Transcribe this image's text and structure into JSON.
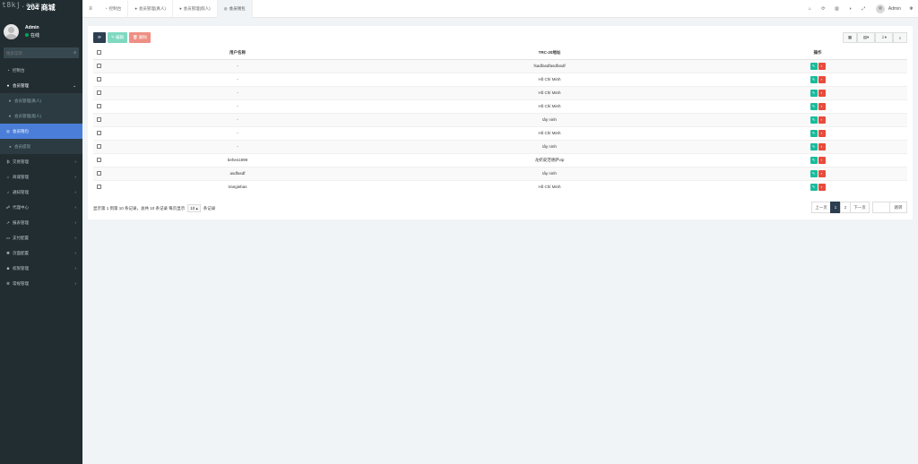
{
  "brand": {
    "watermark": "t8kj.com",
    "title": "204 商城"
  },
  "user": {
    "name": "Admin",
    "status": "在线"
  },
  "sidebar_search": {
    "placeholder": "搜索菜单"
  },
  "menu": [
    {
      "label": "控制台",
      "icon": "dashboard-icon",
      "glyph": "◔",
      "chevron": "",
      "state": ""
    },
    {
      "label": "会员管理",
      "icon": "user-icon",
      "glyph": "●",
      "chevron": "⌄",
      "state": "open"
    },
    {
      "label": "会员管理(真人)",
      "icon": "user-icon",
      "glyph": "●",
      "chevron": "",
      "state": "sub"
    },
    {
      "label": "会员管理(假人)",
      "icon": "user-icon",
      "glyph": "●",
      "chevron": "",
      "state": "sub"
    },
    {
      "label": "会员钱包",
      "icon": "wallet-icon",
      "glyph": "◎",
      "chevron": "",
      "state": "active"
    },
    {
      "label": "会员提现",
      "icon": "volume-icon",
      "glyph": "◂",
      "chevron": "",
      "state": "sub"
    },
    {
      "label": "交易管理",
      "icon": "bitcoin-icon",
      "glyph": "₿",
      "chevron": "‹",
      "state": ""
    },
    {
      "label": "商城管理",
      "icon": "home-icon",
      "glyph": "⌂",
      "chevron": "‹",
      "state": ""
    },
    {
      "label": "通知管理",
      "icon": "bell-icon",
      "glyph": "♪",
      "chevron": "‹",
      "state": ""
    },
    {
      "label": "代理中心",
      "icon": "sitemap-icon",
      "glyph": "☍",
      "chevron": "‹",
      "state": ""
    },
    {
      "label": "报表管理",
      "icon": "chart-icon",
      "glyph": "↗",
      "chevron": "‹",
      "state": ""
    },
    {
      "label": "支付配置",
      "icon": "card-icon",
      "glyph": "▭",
      "chevron": "‹",
      "state": ""
    },
    {
      "label": "页面配置",
      "icon": "gear-icon",
      "glyph": "✱",
      "chevron": "‹",
      "state": ""
    },
    {
      "label": "权限管理",
      "icon": "users-icon",
      "glyph": "☻",
      "chevron": "‹",
      "state": ""
    },
    {
      "label": "常规管理",
      "icon": "cogs-icon",
      "glyph": "✻",
      "chevron": "‹",
      "state": ""
    }
  ],
  "tabs": [
    {
      "label": "控制台",
      "icon": "dashboard-icon",
      "glyph": "◔",
      "active": false
    },
    {
      "label": "会员管理(真人)",
      "icon": "user-icon",
      "glyph": "●",
      "active": false
    },
    {
      "label": "会员管理(假人)",
      "icon": "user-icon",
      "glyph": "●",
      "active": false
    },
    {
      "label": "会员钱包",
      "icon": "wallet-icon",
      "glyph": "◎",
      "active": true
    }
  ],
  "toolbar": {
    "refresh_glyph": "⟳",
    "edit_label": "✎ 编辑",
    "delete_label": "🗑 删除"
  },
  "table": {
    "headers": [
      "用户名称",
      "TRC-20地址",
      "操作"
    ],
    "rows": [
      {
        "name": "-",
        "address": "fsadfasdfasdfasdf"
      },
      {
        "name": "-",
        "address": "Hồ Chí Minh"
      },
      {
        "name": "-",
        "address": "Hồ Chí Minh"
      },
      {
        "name": "-",
        "address": "Hồ Chí Minh"
      },
      {
        "name": "-",
        "address": "tây ninh"
      },
      {
        "name": "-",
        "address": "Hồ Chí Minh"
      },
      {
        "name": "-",
        "address": "tây ninh"
      },
      {
        "name": "behes1999",
        "address": "龙虾皮范德萨vip"
      },
      {
        "name": "asdfasdf",
        "address": "tây ninh"
      },
      {
        "name": "trangiebas",
        "address": "Hồ Chí Minh"
      }
    ]
  },
  "footer": {
    "info_before": "显示第 1 到第 10 条记录，总共 10 条记录 每页显示",
    "page_size": "10 ▴",
    "info_after": "条记录"
  },
  "pager": {
    "prev": "上一页",
    "page1": "1",
    "page2": "2",
    "next": "下一页",
    "jump": "跳转"
  }
}
